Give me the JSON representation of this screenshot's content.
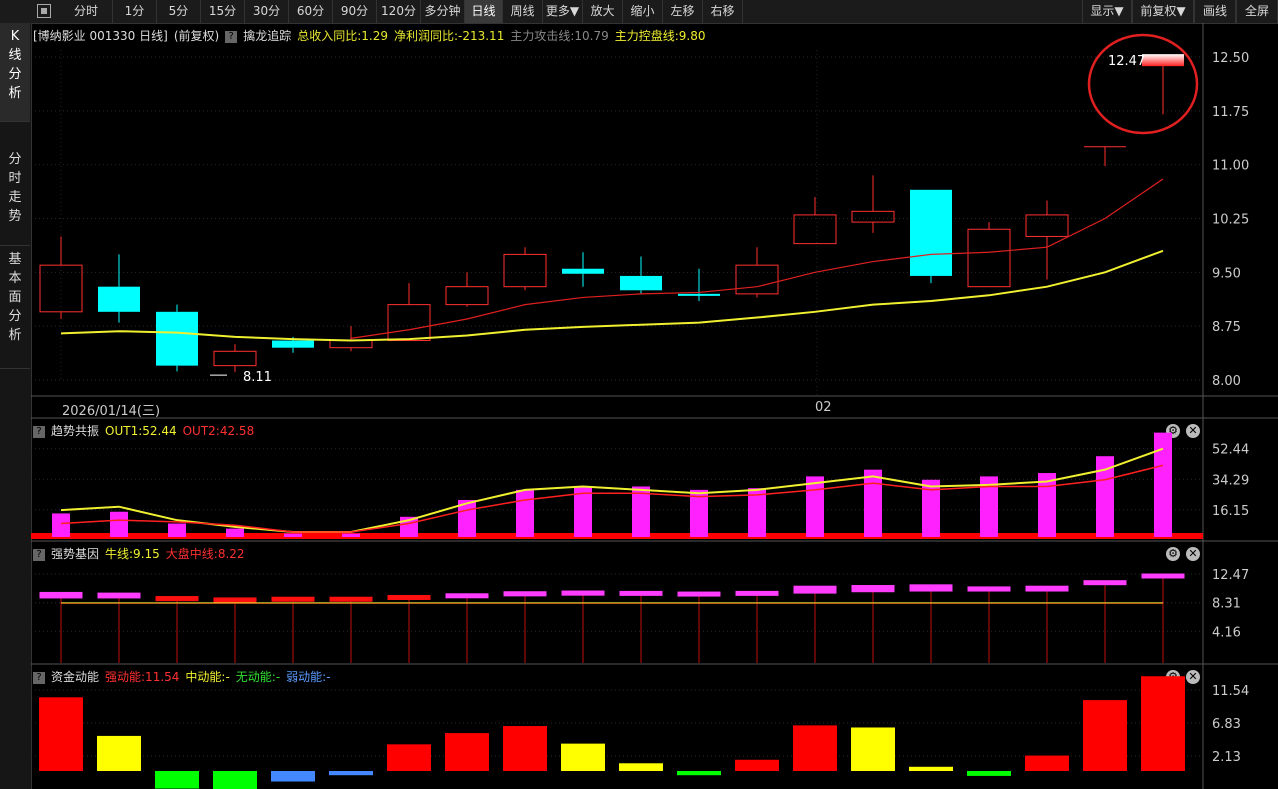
{
  "toolbar": {
    "left": [
      "分时",
      "1分",
      "5分",
      "15分",
      "30分",
      "60分",
      "90分",
      "120分",
      "多分钟",
      "日线",
      "周线",
      "更多▼",
      "放大",
      "缩小",
      "左移",
      "右移"
    ],
    "active": "日线",
    "right": [
      "显示▼",
      "前复权▼",
      "画线",
      "全屏"
    ]
  },
  "sidebar": {
    "items": [
      "K线分析",
      "分时走势",
      "基本面分析"
    ]
  },
  "main": {
    "title": "[博纳影业 001330 日线]",
    "adjust": "(前复权)",
    "indicator": "擒龙追踪",
    "stats": [
      {
        "text": "总收入同比:1.29",
        "color": "#e8e830"
      },
      {
        "text": "净利润同比:-213.11",
        "color": "#e8e830"
      },
      {
        "text": "主力攻击线:10.79",
        "color": "#888888"
      },
      {
        "text": "主力控盘线:9.80",
        "color": "#f0f030"
      }
    ],
    "yticks": [
      "12.50",
      "11.75",
      "11.00",
      "10.25",
      "9.50",
      "8.75",
      "8.00"
    ],
    "date_left": "2026/01/14(三)",
    "date_mid": "02",
    "low_label": "8.11",
    "high_label": "12.47"
  },
  "panels": [
    {
      "title": "趋势共振",
      "fields": [
        {
          "text": "OUT1:52.44",
          "color": "#f0f030"
        },
        {
          "text": "OUT2:42.58",
          "color": "#ff3030"
        }
      ],
      "ticks": [
        "52.44",
        "34.29",
        "16.15"
      ]
    },
    {
      "title": "强势基因",
      "fields": [
        {
          "text": "牛线:9.15",
          "color": "#f0f030"
        },
        {
          "text": "大盘中线:8.22",
          "color": "#ff3030"
        }
      ],
      "ticks": [
        "12.47",
        "8.31",
        "4.16"
      ]
    },
    {
      "title": "资金动能",
      "fields": [
        {
          "text": "强动能:11.54",
          "color": "#ff3030"
        },
        {
          "text": "中动能:-",
          "color": "#f0f030"
        },
        {
          "text": "无动能:-",
          "color": "#30e030"
        },
        {
          "text": "弱动能:-",
          "color": "#5a9cff"
        }
      ],
      "ticks": [
        "11.54",
        "6.83",
        "2.13"
      ]
    }
  ],
  "chart_data": {
    "type": "candlestick",
    "candles": [
      {
        "o": 9.6,
        "c": 8.95,
        "h": 10.0,
        "l": 8.85,
        "up": true
      },
      {
        "o": 9.3,
        "c": 8.95,
        "h": 9.75,
        "l": 8.8,
        "up": false
      },
      {
        "o": 8.95,
        "c": 8.2,
        "h": 9.05,
        "l": 8.12,
        "up": false
      },
      {
        "o": 8.2,
        "c": 8.4,
        "h": 8.5,
        "l": 8.11,
        "up": true
      },
      {
        "o": 8.55,
        "c": 8.45,
        "h": 8.6,
        "l": 8.38,
        "up": false
      },
      {
        "o": 8.45,
        "c": 8.55,
        "h": 8.75,
        "l": 8.4,
        "up": true
      },
      {
        "o": 8.55,
        "c": 9.05,
        "h": 9.35,
        "l": 8.55,
        "up": true
      },
      {
        "o": 9.05,
        "c": 9.3,
        "h": 9.5,
        "l": 9.02,
        "up": true
      },
      {
        "o": 9.3,
        "c": 9.75,
        "h": 9.85,
        "l": 9.25,
        "up": true
      },
      {
        "o": 9.55,
        "c": 9.48,
        "h": 9.78,
        "l": 9.3,
        "up": false
      },
      {
        "o": 9.45,
        "c": 9.25,
        "h": 9.72,
        "l": 9.2,
        "up": false
      },
      {
        "o": 9.2,
        "c": 9.18,
        "h": 9.55,
        "l": 9.1,
        "up": false
      },
      {
        "o": 9.2,
        "c": 9.6,
        "h": 9.85,
        "l": 9.15,
        "up": true
      },
      {
        "o": 9.9,
        "c": 10.3,
        "h": 10.55,
        "l": 9.9,
        "up": true
      },
      {
        "o": 10.2,
        "c": 10.35,
        "h": 10.85,
        "l": 10.05,
        "up": true
      },
      {
        "o": 10.65,
        "c": 9.45,
        "h": 10.65,
        "l": 9.35,
        "up": false
      },
      {
        "o": 9.3,
        "c": 10.1,
        "h": 10.2,
        "l": 9.3,
        "up": true
      },
      {
        "o": 10.0,
        "c": 10.3,
        "h": 10.5,
        "l": 9.4,
        "up": true
      },
      {
        "o": 11.25,
        "c": 11.25,
        "h": 11.25,
        "l": 10.98,
        "up": true
      },
      {
        "o": 12.47,
        "c": 12.47,
        "h": 12.47,
        "l": 11.7,
        "up": true
      }
    ],
    "ma_red": [
      null,
      null,
      null,
      null,
      null,
      8.58,
      8.7,
      8.85,
      9.05,
      9.15,
      9.2,
      9.22,
      9.3,
      9.5,
      9.65,
      9.75,
      9.78,
      9.85,
      10.25,
      10.8
    ],
    "ma_yellow": [
      8.65,
      8.68,
      8.66,
      8.6,
      8.57,
      8.55,
      8.57,
      8.62,
      8.7,
      8.74,
      8.77,
      8.8,
      8.87,
      8.95,
      9.05,
      9.1,
      9.18,
      9.3,
      9.5,
      9.8
    ],
    "trend_bars": [
      14,
      15,
      8,
      5,
      2,
      2,
      12,
      22,
      28,
      30,
      30,
      28,
      29,
      36,
      40,
      34,
      36,
      38,
      48,
      62
    ],
    "trend_out1": [
      16,
      18,
      10,
      6,
      3,
      3,
      10,
      20,
      28,
      30,
      28,
      26,
      28,
      32,
      36,
      30,
      31,
      33,
      40,
      52.44
    ],
    "trend_out2": [
      8,
      10,
      9,
      7,
      3,
      3,
      8,
      16,
      22,
      26,
      26,
      24,
      25,
      28,
      32,
      28,
      30,
      30,
      34,
      42.58
    ],
    "gene_top": [
      9.8,
      9.7,
      9.2,
      9.0,
      9.1,
      9.1,
      9.35,
      9.6,
      9.9,
      10.0,
      9.95,
      9.85,
      9.95,
      10.7,
      10.8,
      10.9,
      10.6,
      10.7,
      11.5,
      12.47
    ],
    "gene_bot": [
      9.0,
      9.0,
      8.6,
      8.55,
      8.6,
      8.6,
      8.8,
      9.15,
      9.3,
      9.4,
      9.4,
      9.3,
      9.4,
      9.7,
      9.9,
      10.0,
      10.0,
      10.0,
      11.2,
      12.0
    ],
    "gene_color": [
      "#ff3cff",
      "#ff3cff",
      "#ff1010",
      "#ff1010",
      "#ff1010",
      "#ff1010",
      "#ff1010",
      "#ff3cff",
      "#ff3cff",
      "#ff3cff",
      "#ff3cff",
      "#ff3cff",
      "#ff3cff",
      "#ff3cff",
      "#ff3cff",
      "#ff3cff",
      "#ff3cff",
      "#ff3cff",
      "#ff3cff",
      "#ff3cff"
    ],
    "energy": [
      {
        "v": 10.5,
        "c": "#ff0000"
      },
      {
        "v": 5.0,
        "c": "#ffff00"
      },
      {
        "v": -2.5,
        "c": "#00ff00"
      },
      {
        "v": -3.0,
        "c": "#00ff00"
      },
      {
        "v": -1.5,
        "c": "#4488ff"
      },
      {
        "v": -0.6,
        "c": "#4488ff"
      },
      {
        "v": 3.8,
        "c": "#ff0000"
      },
      {
        "v": 5.4,
        "c": "#ff0000"
      },
      {
        "v": 6.4,
        "c": "#ff0000"
      },
      {
        "v": 3.9,
        "c": "#ffff00"
      },
      {
        "v": 1.1,
        "c": "#ffff00"
      },
      {
        "v": -0.6,
        "c": "#00ff00"
      },
      {
        "v": 1.6,
        "c": "#ff0000"
      },
      {
        "v": 6.5,
        "c": "#ff0000"
      },
      {
        "v": 6.2,
        "c": "#ffff00"
      },
      {
        "v": 0.6,
        "c": "#ffff00"
      },
      {
        "v": -0.7,
        "c": "#00ff00"
      },
      {
        "v": 2.2,
        "c": "#ff0000"
      },
      {
        "v": 10.1,
        "c": "#ff0000"
      },
      {
        "v": 13.5,
        "c": "#ff0000"
      }
    ],
    "price_range": [
      8.0,
      12.5
    ],
    "colors": {
      "up": "#ff3030",
      "down": "#00ffff",
      "ma_red": "#e02020",
      "ma_yellow": "#f0f030",
      "grid": "#2a2a2a"
    }
  }
}
